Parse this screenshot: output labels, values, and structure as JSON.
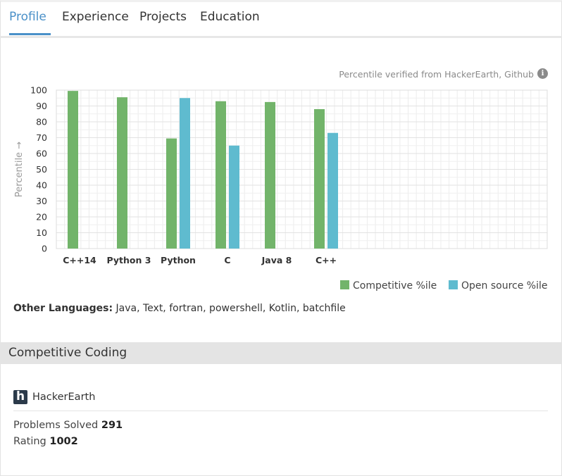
{
  "tabs": [
    {
      "label": "Profile",
      "active": true
    },
    {
      "label": "Experience",
      "active": false
    },
    {
      "label": "Projects",
      "active": false
    },
    {
      "label": "Education",
      "active": false
    }
  ],
  "note": "Percentile verified from HackerEarth, Github",
  "colors": {
    "competitive": "#72b46a",
    "open_source": "#5fbbcf",
    "accent": "#4a90c8"
  },
  "chart_data": {
    "type": "bar",
    "ylabel": "Percentile →",
    "ylim": [
      0,
      100
    ],
    "yticks": [
      0,
      10,
      20,
      30,
      40,
      50,
      60,
      70,
      80,
      90,
      100
    ],
    "categories": [
      "C++14",
      "Python 3",
      "Python",
      "C",
      "Java 8",
      "C++"
    ],
    "series": [
      {
        "name": "Competitive %ile",
        "color": "#72b46a",
        "values": [
          99.5,
          95.5,
          69.5,
          93,
          92.5,
          88
        ]
      },
      {
        "name": "Open source %ile",
        "color": "#5fbbcf",
        "values": [
          null,
          null,
          95,
          65,
          null,
          73
        ]
      }
    ],
    "grid": true,
    "legend": "bottom-right"
  },
  "other_languages": {
    "label": "Other Languages:",
    "value": "Java, Text, fortran, powershell, Kotlin, batchfile"
  },
  "section": {
    "title": "Competitive Coding"
  },
  "hackerearth": {
    "logo_letter": "h",
    "name": "HackerEarth",
    "problems_label": "Problems Solved",
    "problems_value": "291",
    "rating_label": "Rating",
    "rating_value": "1002"
  }
}
